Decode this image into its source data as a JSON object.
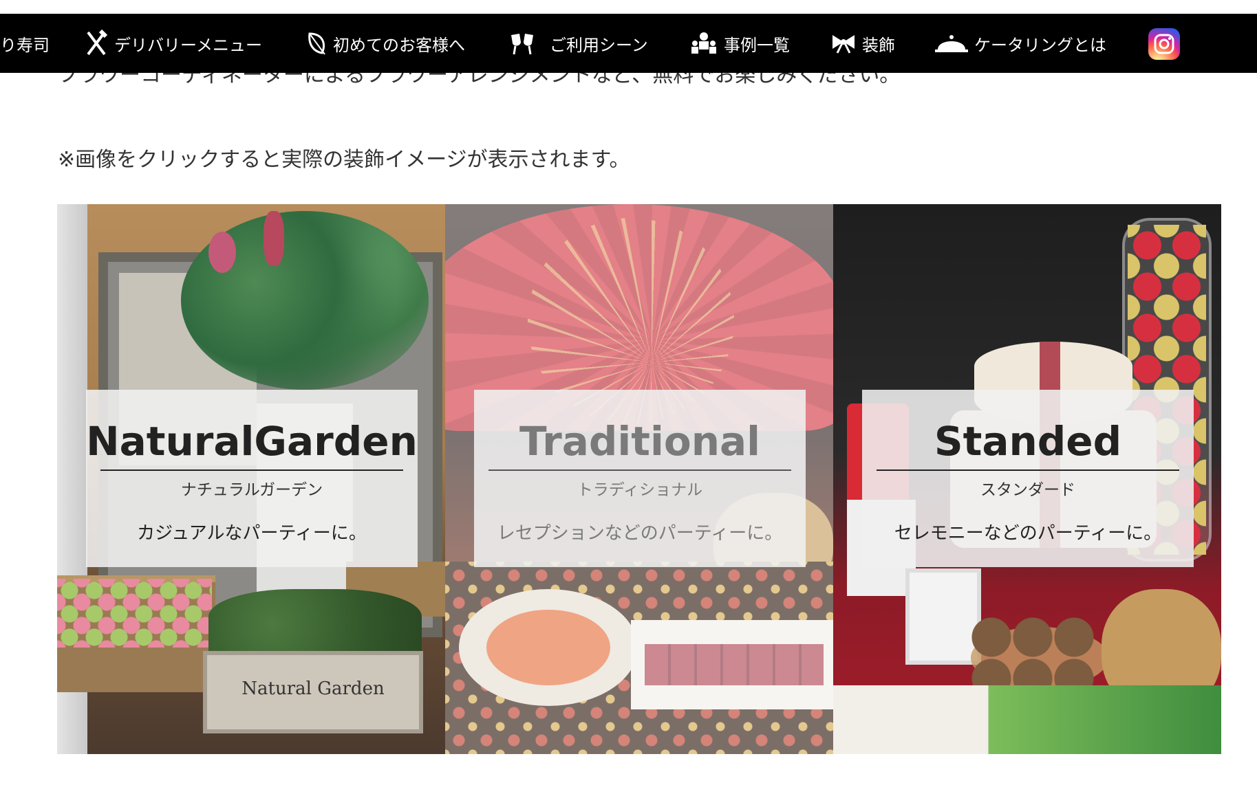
{
  "nav": {
    "items": [
      {
        "label": "り寿司",
        "icon": "none"
      },
      {
        "label": "デリバリーメニュー",
        "icon": "utensils-icon"
      },
      {
        "label": "初めてのお客様へ",
        "icon": "leaf-icon"
      },
      {
        "label": "ご利用シーン",
        "icon": "toast-glasses-icon"
      },
      {
        "label": "事例一覧",
        "icon": "people-icon"
      },
      {
        "label": "装飾",
        "icon": "ribbon-bow-icon"
      },
      {
        "label": "ケータリングとは",
        "icon": "cloche-icon"
      }
    ],
    "instagram_icon": "instagram-icon"
  },
  "intro_text": "フラワーコーディネーターによるフラワーアレンジメントなど、無料でお楽しみください。",
  "note": "※画像をクリックすると実際の装飾イメージが表示されます。",
  "panels": [
    {
      "title": "NaturalGarden",
      "subtitle": "ナチュラルガーデン",
      "description": "カジュアルなパーティーに。",
      "photo_text": "Natural Garden"
    },
    {
      "title": "Traditional",
      "subtitle": "トラディショナル",
      "description": "レセプションなどのパーティーに。"
    },
    {
      "title": "Standed",
      "subtitle": "スタンダード",
      "description": "セレモニーなどのパーティーに。"
    }
  ]
}
